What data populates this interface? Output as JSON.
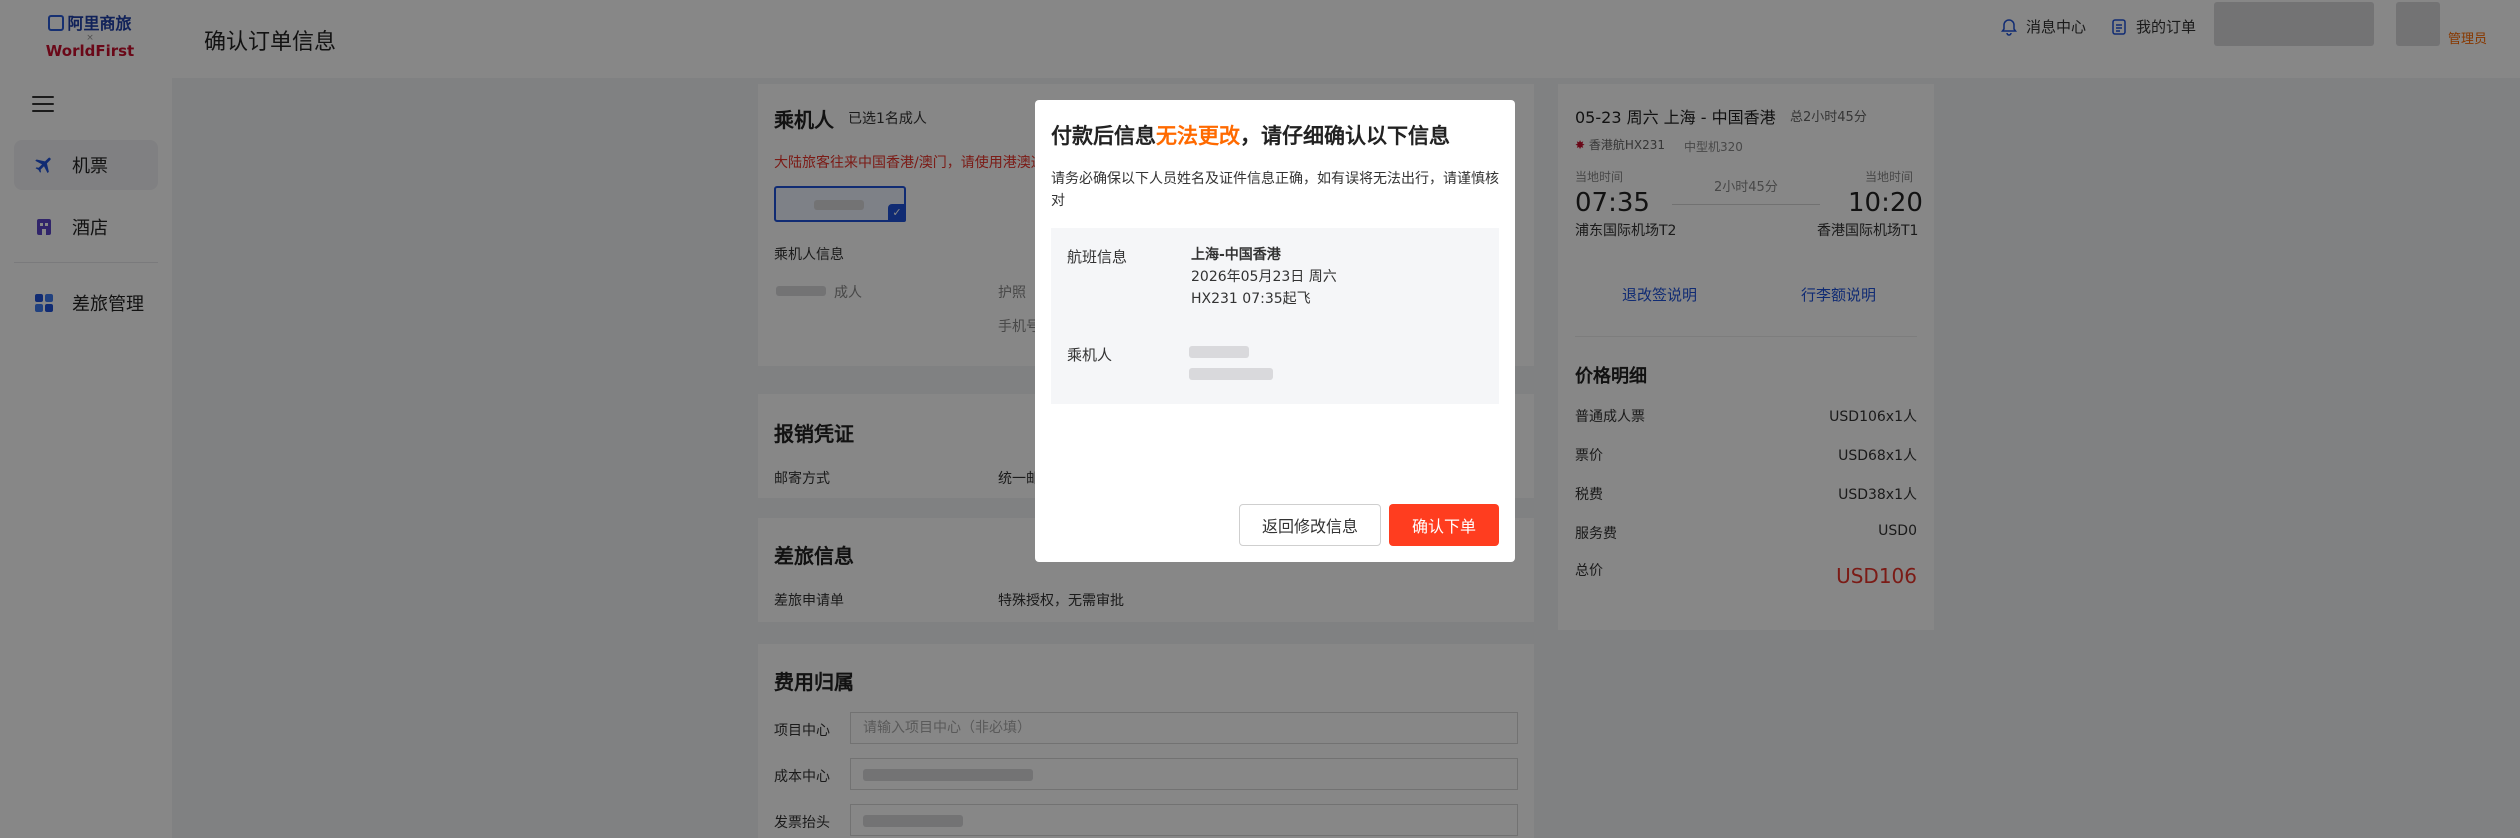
{
  "sidebar": {
    "logo_line1": "阿里商旅",
    "logo_x": "×",
    "logo_line2": "WorldFirst",
    "items": [
      {
        "label": "机票",
        "icon": "airplane-icon"
      },
      {
        "label": "酒店",
        "icon": "hotel-icon"
      },
      {
        "label": "差旅管理",
        "icon": "grid-icon"
      }
    ]
  },
  "header": {
    "title": "确认订单信息",
    "messages": "消息中心",
    "my_orders": "我的订单",
    "role": "管理员"
  },
  "passenger_card": {
    "title": "乘机人",
    "selected": "已选1名成人",
    "notice": "大陆旅客往来中国香港/澳门，请使用港澳通",
    "info_heading": "乘机人信息",
    "adult_tag": "成人",
    "doc_label": "护照",
    "phone_label": "手机号"
  },
  "reimbursement": {
    "title": "报销凭证",
    "mail_label": "邮寄方式",
    "mail_value": "统一邮"
  },
  "travel_info": {
    "title": "差旅信息",
    "request_label": "差旅申请单",
    "request_value": "特殊授权，无需审批"
  },
  "cost": {
    "title": "费用归属",
    "project_label": "项目中心",
    "project_placeholder": "请输入项目中心（非必填）",
    "cost_center_label": "成本中心",
    "invoice_label": "发票抬头"
  },
  "flight_summary": {
    "route": "05-23 周六 上海 - 中国香港",
    "duration_total": "总2小时45分",
    "airline": "香港航HX231",
    "aircraft": "中型机320",
    "dep_label": "当地时间",
    "arr_label": "当地时间",
    "dep_time": "07:35",
    "arr_time": "10:20",
    "flight_duration": "2小时45分",
    "dep_airport": "浦东国际机场T2",
    "arr_airport": "香港国际机场T1",
    "refund_link": "退改签说明",
    "baggage_link": "行李额说明"
  },
  "price": {
    "title": "价格明细",
    "rows": [
      {
        "label": "普通成人票",
        "value": "USD106x1人"
      },
      {
        "label": "票价",
        "value": "USD68x1人"
      },
      {
        "label": "税费",
        "value": "USD38x1人"
      },
      {
        "label": "服务费",
        "value": "USD0"
      }
    ],
    "total_label": "总价",
    "total_value": "USD106"
  },
  "modal": {
    "title_before": "付款后信息",
    "title_warn": "无法更改",
    "title_after": "，请仔细确认以下信息",
    "description": "请务必确保以下人员姓名及证件信息正确，如有误将无法出行，请谨慎核对",
    "flight_label": "航班信息",
    "flight_route": "上海-中国香港",
    "flight_date": "2026年05月23日 周六",
    "flight_no_time": "HX231 07:35起飞",
    "passenger_label": "乘机人",
    "back_button": "返回修改信息",
    "confirm_button": "确认下单"
  },
  "colors": {
    "accent_orange": "#ff6a00",
    "confirm_red": "#ff3d1f",
    "link_blue": "#1f52d9",
    "price_red": "#e8332a"
  }
}
